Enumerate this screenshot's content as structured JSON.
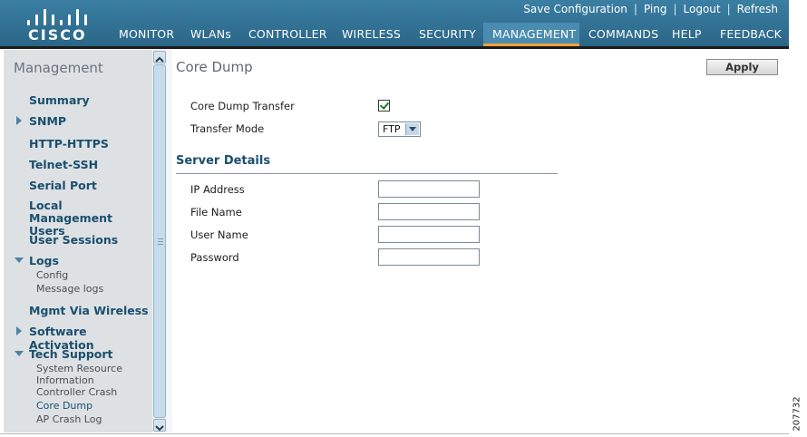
{
  "brand": {
    "name": "CISCO"
  },
  "top_links": [
    "Save Configuration",
    "Ping",
    "Logout",
    "Refresh"
  ],
  "nav": {
    "items": [
      "MONITOR",
      "WLANs",
      "CONTROLLER",
      "WIRELESS",
      "SECURITY",
      "MANAGEMENT",
      "COMMANDS",
      "HELP",
      "FEEDBACK"
    ],
    "active": "MANAGEMENT"
  },
  "sidebar": {
    "title": "Management",
    "items": [
      {
        "label": "Summary"
      },
      {
        "label": "SNMP"
      },
      {
        "label": "HTTP-HTTPS"
      },
      {
        "label": "Telnet-SSH"
      },
      {
        "label": "Serial Port"
      },
      {
        "label": "Local Management Users"
      },
      {
        "label": "User Sessions"
      },
      {
        "label": "Logs",
        "children": [
          "Config",
          "Message logs"
        ]
      },
      {
        "label": "Mgmt Via Wireless"
      },
      {
        "label": "Software Activation"
      },
      {
        "label": "Tech Support",
        "children": [
          "System Resource Information",
          "Controller Crash",
          "Core Dump",
          "AP Crash Log"
        ]
      }
    ]
  },
  "main": {
    "title": "Core Dump",
    "apply_label": "Apply",
    "core_dump_transfer": {
      "label": "Core Dump Transfer",
      "checked": true
    },
    "transfer_mode": {
      "label": "Transfer Mode",
      "value": "FTP"
    },
    "server_details": {
      "title": "Server Details",
      "fields": [
        {
          "label": "IP Address",
          "value": ""
        },
        {
          "label": "File Name",
          "value": ""
        },
        {
          "label": "User Name",
          "value": ""
        },
        {
          "label": "Password",
          "value": ""
        }
      ]
    }
  },
  "figure_number": "207732",
  "colors": {
    "header": "#2d6e90",
    "accent": "#f2a03b",
    "link": "#1b4e6e",
    "sidebar_bg": "#dde1e4"
  }
}
